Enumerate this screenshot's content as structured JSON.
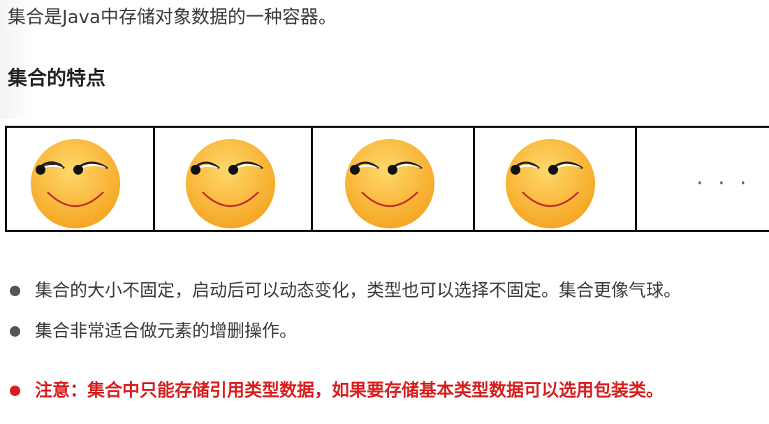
{
  "intro": "集合是Java中存储对象数据的一种容器。",
  "heading": "集合的特点",
  "slots": {
    "icon": "smirk-emoji-icon",
    "count": 4,
    "more": "· · ·"
  },
  "bullets": [
    "集合的大小不固定，启动后可以动态变化，类型也可以选择不固定。集合更像气球。",
    "集合非常适合做元素的增删操作。"
  ],
  "note": "注意：集合中只能存储引用类型数据，如果要存储基本类型数据可以选用包装类。",
  "colors": {
    "note": "#d81e1e",
    "emoji": "#f9b92e",
    "text": "#3a3a3a"
  }
}
